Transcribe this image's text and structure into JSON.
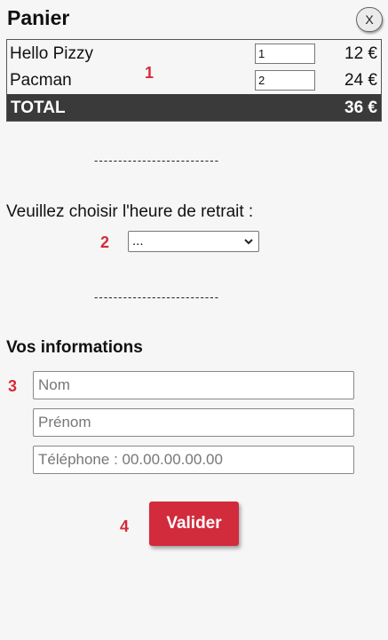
{
  "header": {
    "title": "Panier",
    "close_label": "X"
  },
  "cart": {
    "items": [
      {
        "name": "Hello Pizzy",
        "quantity": "1",
        "price": "12 €"
      },
      {
        "name": "Pacman",
        "quantity": "2",
        "price": "24 €"
      }
    ],
    "total_label": "TOTAL",
    "total_value": "36 €"
  },
  "separator": "--------------------------",
  "pickup": {
    "label": "Veuillez choisir l'heure de retrait :",
    "selected": "..."
  },
  "info": {
    "title": "Vos informations",
    "fields": [
      {
        "placeholder": "Nom"
      },
      {
        "placeholder": "Prénom"
      },
      {
        "placeholder": "Téléphone : 00.00.00.00.00"
      }
    ]
  },
  "actions": {
    "validate_label": "Valider"
  },
  "annotations": [
    "1",
    "2",
    "3",
    "4"
  ],
  "colors": {
    "accent": "#d22b3c",
    "total_bar": "#3a3a3a",
    "background": "#f6f6f6"
  }
}
